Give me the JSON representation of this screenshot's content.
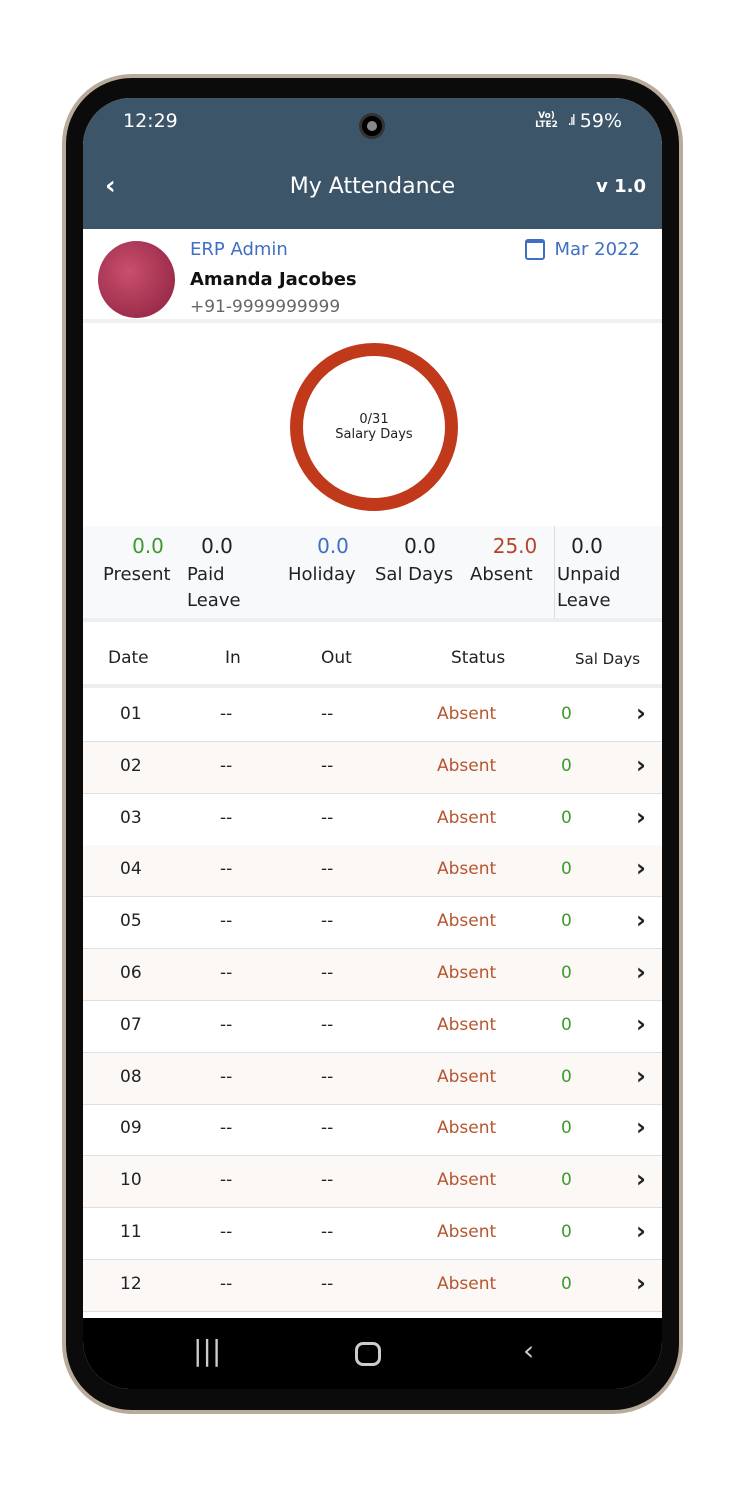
{
  "status_bar": {
    "time": "12:29",
    "battery": "59%",
    "signal": "Vo) LTE2"
  },
  "header": {
    "title": "My Attendance",
    "version": "v 1.0"
  },
  "profile": {
    "role": "ERP Admin",
    "name": "Amanda Jacobes",
    "phone": "+91-9999999999",
    "month": "Mar 2022"
  },
  "summary": {
    "salary_days": "0/31",
    "salary_days_label": "Salary Days"
  },
  "stats": [
    {
      "value": "0.0",
      "label": "Present",
      "color": "#3e9a2f"
    },
    {
      "value": "0.0",
      "label": "Paid Leave",
      "color": "#222222"
    },
    {
      "value": "0.0",
      "label": "Holiday",
      "color": "#3f6fc4"
    },
    {
      "value": "0.0",
      "label": "Sal Days",
      "color": "#222222"
    },
    {
      "value": "25.0",
      "label": "Absent",
      "color": "#b5452a"
    },
    {
      "value": "0.0",
      "label": "Unpaid Leave",
      "color": "#222222"
    }
  ],
  "table": {
    "columns": [
      "Date",
      "In",
      "Out",
      "Status",
      "Sal Days"
    ],
    "rows": [
      {
        "date": "01",
        "in": "--",
        "out": "--",
        "status": "Absent",
        "sal": "0"
      },
      {
        "date": "02",
        "in": "--",
        "out": "--",
        "status": "Absent",
        "sal": "0"
      },
      {
        "date": "03",
        "in": "--",
        "out": "--",
        "status": "Absent",
        "sal": "0"
      },
      {
        "date": "04",
        "in": "--",
        "out": "--",
        "status": "Absent",
        "sal": "0"
      },
      {
        "date": "05",
        "in": "--",
        "out": "--",
        "status": "Absent",
        "sal": "0"
      },
      {
        "date": "06",
        "in": "--",
        "out": "--",
        "status": "Absent",
        "sal": "0"
      },
      {
        "date": "07",
        "in": "--",
        "out": "--",
        "status": "Absent",
        "sal": "0"
      },
      {
        "date": "08",
        "in": "--",
        "out": "--",
        "status": "Absent",
        "sal": "0"
      },
      {
        "date": "09",
        "in": "--",
        "out": "--",
        "status": "Absent",
        "sal": "0"
      },
      {
        "date": "10",
        "in": "--",
        "out": "--",
        "status": "Absent",
        "sal": "0"
      },
      {
        "date": "11",
        "in": "--",
        "out": "--",
        "status": "Absent",
        "sal": "0"
      },
      {
        "date": "12",
        "in": "--",
        "out": "--",
        "status": "Absent",
        "sal": "0"
      }
    ]
  },
  "colors": {
    "header": "#3d5568",
    "accent": "#3f6fc4",
    "absent": "#b5552f",
    "present": "#3e9a2f",
    "ring": "#c0391b"
  }
}
